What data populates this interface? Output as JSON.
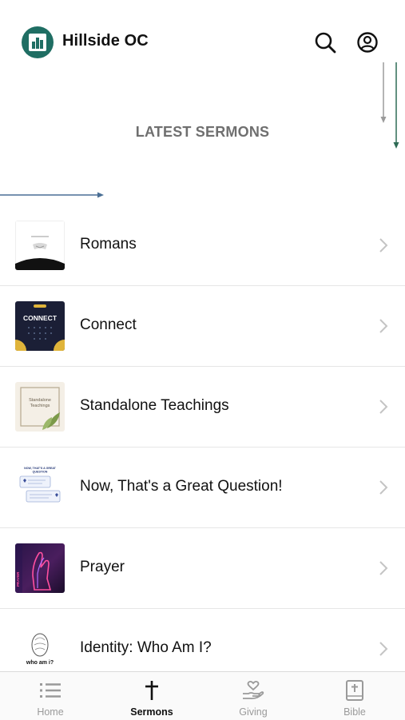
{
  "header": {
    "app_title": "Hillside OC",
    "brand_color": "#1f6e63"
  },
  "hero": {
    "section_title": "LATEST SERMONS"
  },
  "sermons": [
    {
      "label": "Romans"
    },
    {
      "label": "Connect",
      "thumb_text": "CONNECT"
    },
    {
      "label": "Standalone Teachings",
      "thumb_text": "Standalone Teachings"
    },
    {
      "label": "Now, That's a Great Question!",
      "thumb_text": "NOW, THAT'S A GREAT QUESTION"
    },
    {
      "label": "Prayer",
      "thumb_text": "PRAYER"
    },
    {
      "label": "Identity: Who Am I?",
      "thumb_text": "who am i?"
    }
  ],
  "tabbar": {
    "tabs": [
      {
        "label": "Home",
        "icon": "list-icon"
      },
      {
        "label": "Sermons",
        "icon": "cross-icon",
        "active": true
      },
      {
        "label": "Giving",
        "icon": "heart-hand-icon"
      },
      {
        "label": "Bible",
        "icon": "bible-icon"
      }
    ]
  }
}
